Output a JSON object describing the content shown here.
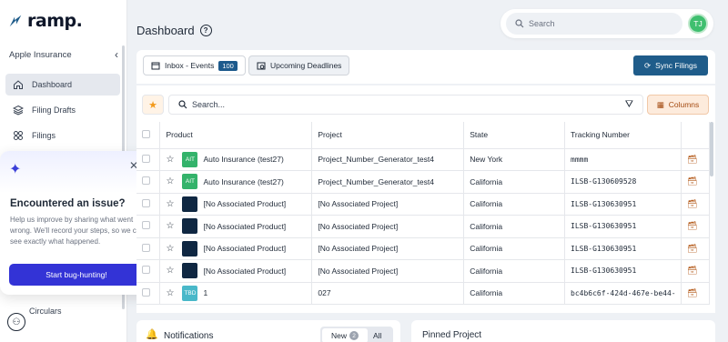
{
  "brand": {
    "name": "ramp."
  },
  "sidebar": {
    "company": "Apple Insurance",
    "items": [
      {
        "label": "Dashboard",
        "icon": "home-icon",
        "active": true
      },
      {
        "label": "Filing Drafts",
        "icon": "layers-icon",
        "active": false
      },
      {
        "label": "Filings",
        "icon": "grid-icon",
        "active": false
      }
    ],
    "circulars": "Circulars"
  },
  "bug_popup": {
    "title": "Encountered an issue?",
    "description": "Help us improve by sharing what went wrong. We'll record your steps, so we can see exactly what happened.",
    "button": "Start bug-hunting!"
  },
  "header": {
    "title": "Dashboard",
    "search_placeholder": "Search",
    "avatar_initials": "TJ"
  },
  "tabs": [
    {
      "label": "Inbox - Events",
      "count": "100"
    },
    {
      "label": "Upcoming Deadlines"
    }
  ],
  "sync_button": "Sync Filings",
  "table": {
    "search_placeholder": "Search...",
    "columns_button": "Columns",
    "headers": [
      "Product",
      "Project",
      "State",
      "Tracking Number"
    ],
    "rows": [
      {
        "tag": "AIT",
        "tag_color": "green",
        "product": "Auto Insurance (test27)",
        "project": "Project_Number_Generator_test4",
        "state": "New York",
        "tracking": "mmmm"
      },
      {
        "tag": "AIT",
        "tag_color": "green",
        "product": "Auto Insurance (test27)",
        "project": "Project_Number_Generator_test4",
        "state": "California",
        "tracking": "ILSB-G130609528"
      },
      {
        "tag": "",
        "tag_color": "navy",
        "product": "[No Associated Product]",
        "project": "[No Associated Project]",
        "state": "California",
        "tracking": "ILSB-G130630951"
      },
      {
        "tag": "",
        "tag_color": "navy",
        "product": "[No Associated Product]",
        "project": "[No Associated Project]",
        "state": "California",
        "tracking": "ILSB-G130630951"
      },
      {
        "tag": "",
        "tag_color": "navy",
        "product": "[No Associated Product]",
        "project": "[No Associated Project]",
        "state": "California",
        "tracking": "ILSB-G130630951"
      },
      {
        "tag": "",
        "tag_color": "navy",
        "product": "[No Associated Product]",
        "project": "[No Associated Project]",
        "state": "California",
        "tracking": "ILSB-G130630951"
      },
      {
        "tag": "TBD",
        "tag_color": "teal",
        "product": "1",
        "project": "027",
        "state": "California",
        "tracking": "bc4b6c6f-424d-467e-be44-"
      }
    ]
  },
  "notifications": {
    "label": "Notifications",
    "new_label": "New",
    "new_count": "2",
    "all_label": "All"
  },
  "pinned": {
    "label": "Pinned Project"
  },
  "colors": {
    "primary": "#1f5c8a",
    "bug_button": "#3333d6",
    "avatar": "#3fbf6f",
    "accent_orange": "#f39a1c"
  }
}
